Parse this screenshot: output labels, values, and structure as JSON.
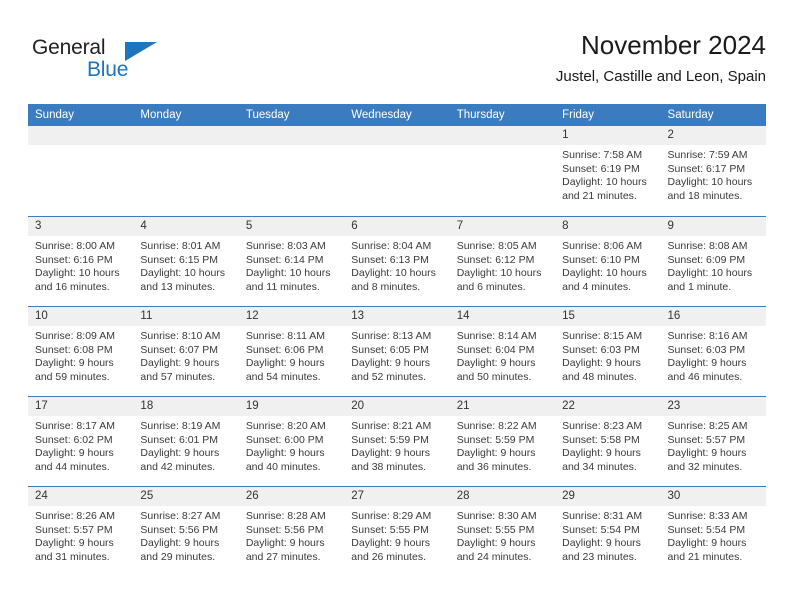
{
  "brand": {
    "name_part1": "General",
    "name_part2": "Blue",
    "accent_color": "#1d75bd",
    "triangle_icon": "triangle-icon"
  },
  "header": {
    "title": "November 2024",
    "subtitle": "Justel, Castille and Leon, Spain"
  },
  "theme": {
    "header_blue": "#3b7cc0",
    "daynum_bg": "#f0f0f0",
    "text": "#3a3a3a"
  },
  "calendar": {
    "weekday_headers": [
      "Sunday",
      "Monday",
      "Tuesday",
      "Wednesday",
      "Thursday",
      "Friday",
      "Saturday"
    ],
    "weeks": [
      [
        {
          "day": "",
          "empty": true
        },
        {
          "day": "",
          "empty": true
        },
        {
          "day": "",
          "empty": true
        },
        {
          "day": "",
          "empty": true
        },
        {
          "day": "",
          "empty": true
        },
        {
          "day": "1",
          "sunrise": "Sunrise: 7:58 AM",
          "sunset": "Sunset: 6:19 PM",
          "daylight1": "Daylight: 10 hours",
          "daylight2": "and 21 minutes."
        },
        {
          "day": "2",
          "sunrise": "Sunrise: 7:59 AM",
          "sunset": "Sunset: 6:17 PM",
          "daylight1": "Daylight: 10 hours",
          "daylight2": "and 18 minutes."
        }
      ],
      [
        {
          "day": "3",
          "sunrise": "Sunrise: 8:00 AM",
          "sunset": "Sunset: 6:16 PM",
          "daylight1": "Daylight: 10 hours",
          "daylight2": "and 16 minutes."
        },
        {
          "day": "4",
          "sunrise": "Sunrise: 8:01 AM",
          "sunset": "Sunset: 6:15 PM",
          "daylight1": "Daylight: 10 hours",
          "daylight2": "and 13 minutes."
        },
        {
          "day": "5",
          "sunrise": "Sunrise: 8:03 AM",
          "sunset": "Sunset: 6:14 PM",
          "daylight1": "Daylight: 10 hours",
          "daylight2": "and 11 minutes."
        },
        {
          "day": "6",
          "sunrise": "Sunrise: 8:04 AM",
          "sunset": "Sunset: 6:13 PM",
          "daylight1": "Daylight: 10 hours",
          "daylight2": "and 8 minutes."
        },
        {
          "day": "7",
          "sunrise": "Sunrise: 8:05 AM",
          "sunset": "Sunset: 6:12 PM",
          "daylight1": "Daylight: 10 hours",
          "daylight2": "and 6 minutes."
        },
        {
          "day": "8",
          "sunrise": "Sunrise: 8:06 AM",
          "sunset": "Sunset: 6:10 PM",
          "daylight1": "Daylight: 10 hours",
          "daylight2": "and 4 minutes."
        },
        {
          "day": "9",
          "sunrise": "Sunrise: 8:08 AM",
          "sunset": "Sunset: 6:09 PM",
          "daylight1": "Daylight: 10 hours",
          "daylight2": "and 1 minute."
        }
      ],
      [
        {
          "day": "10",
          "sunrise": "Sunrise: 8:09 AM",
          "sunset": "Sunset: 6:08 PM",
          "daylight1": "Daylight: 9 hours",
          "daylight2": "and 59 minutes."
        },
        {
          "day": "11",
          "sunrise": "Sunrise: 8:10 AM",
          "sunset": "Sunset: 6:07 PM",
          "daylight1": "Daylight: 9 hours",
          "daylight2": "and 57 minutes."
        },
        {
          "day": "12",
          "sunrise": "Sunrise: 8:11 AM",
          "sunset": "Sunset: 6:06 PM",
          "daylight1": "Daylight: 9 hours",
          "daylight2": "and 54 minutes."
        },
        {
          "day": "13",
          "sunrise": "Sunrise: 8:13 AM",
          "sunset": "Sunset: 6:05 PM",
          "daylight1": "Daylight: 9 hours",
          "daylight2": "and 52 minutes."
        },
        {
          "day": "14",
          "sunrise": "Sunrise: 8:14 AM",
          "sunset": "Sunset: 6:04 PM",
          "daylight1": "Daylight: 9 hours",
          "daylight2": "and 50 minutes."
        },
        {
          "day": "15",
          "sunrise": "Sunrise: 8:15 AM",
          "sunset": "Sunset: 6:03 PM",
          "daylight1": "Daylight: 9 hours",
          "daylight2": "and 48 minutes."
        },
        {
          "day": "16",
          "sunrise": "Sunrise: 8:16 AM",
          "sunset": "Sunset: 6:03 PM",
          "daylight1": "Daylight: 9 hours",
          "daylight2": "and 46 minutes."
        }
      ],
      [
        {
          "day": "17",
          "sunrise": "Sunrise: 8:17 AM",
          "sunset": "Sunset: 6:02 PM",
          "daylight1": "Daylight: 9 hours",
          "daylight2": "and 44 minutes."
        },
        {
          "day": "18",
          "sunrise": "Sunrise: 8:19 AM",
          "sunset": "Sunset: 6:01 PM",
          "daylight1": "Daylight: 9 hours",
          "daylight2": "and 42 minutes."
        },
        {
          "day": "19",
          "sunrise": "Sunrise: 8:20 AM",
          "sunset": "Sunset: 6:00 PM",
          "daylight1": "Daylight: 9 hours",
          "daylight2": "and 40 minutes."
        },
        {
          "day": "20",
          "sunrise": "Sunrise: 8:21 AM",
          "sunset": "Sunset: 5:59 PM",
          "daylight1": "Daylight: 9 hours",
          "daylight2": "and 38 minutes."
        },
        {
          "day": "21",
          "sunrise": "Sunrise: 8:22 AM",
          "sunset": "Sunset: 5:59 PM",
          "daylight1": "Daylight: 9 hours",
          "daylight2": "and 36 minutes."
        },
        {
          "day": "22",
          "sunrise": "Sunrise: 8:23 AM",
          "sunset": "Sunset: 5:58 PM",
          "daylight1": "Daylight: 9 hours",
          "daylight2": "and 34 minutes."
        },
        {
          "day": "23",
          "sunrise": "Sunrise: 8:25 AM",
          "sunset": "Sunset: 5:57 PM",
          "daylight1": "Daylight: 9 hours",
          "daylight2": "and 32 minutes."
        }
      ],
      [
        {
          "day": "24",
          "sunrise": "Sunrise: 8:26 AM",
          "sunset": "Sunset: 5:57 PM",
          "daylight1": "Daylight: 9 hours",
          "daylight2": "and 31 minutes."
        },
        {
          "day": "25",
          "sunrise": "Sunrise: 8:27 AM",
          "sunset": "Sunset: 5:56 PM",
          "daylight1": "Daylight: 9 hours",
          "daylight2": "and 29 minutes."
        },
        {
          "day": "26",
          "sunrise": "Sunrise: 8:28 AM",
          "sunset": "Sunset: 5:56 PM",
          "daylight1": "Daylight: 9 hours",
          "daylight2": "and 27 minutes."
        },
        {
          "day": "27",
          "sunrise": "Sunrise: 8:29 AM",
          "sunset": "Sunset: 5:55 PM",
          "daylight1": "Daylight: 9 hours",
          "daylight2": "and 26 minutes."
        },
        {
          "day": "28",
          "sunrise": "Sunrise: 8:30 AM",
          "sunset": "Sunset: 5:55 PM",
          "daylight1": "Daylight: 9 hours",
          "daylight2": "and 24 minutes."
        },
        {
          "day": "29",
          "sunrise": "Sunrise: 8:31 AM",
          "sunset": "Sunset: 5:54 PM",
          "daylight1": "Daylight: 9 hours",
          "daylight2": "and 23 minutes."
        },
        {
          "day": "30",
          "sunrise": "Sunrise: 8:33 AM",
          "sunset": "Sunset: 5:54 PM",
          "daylight1": "Daylight: 9 hours",
          "daylight2": "and 21 minutes."
        }
      ]
    ]
  }
}
